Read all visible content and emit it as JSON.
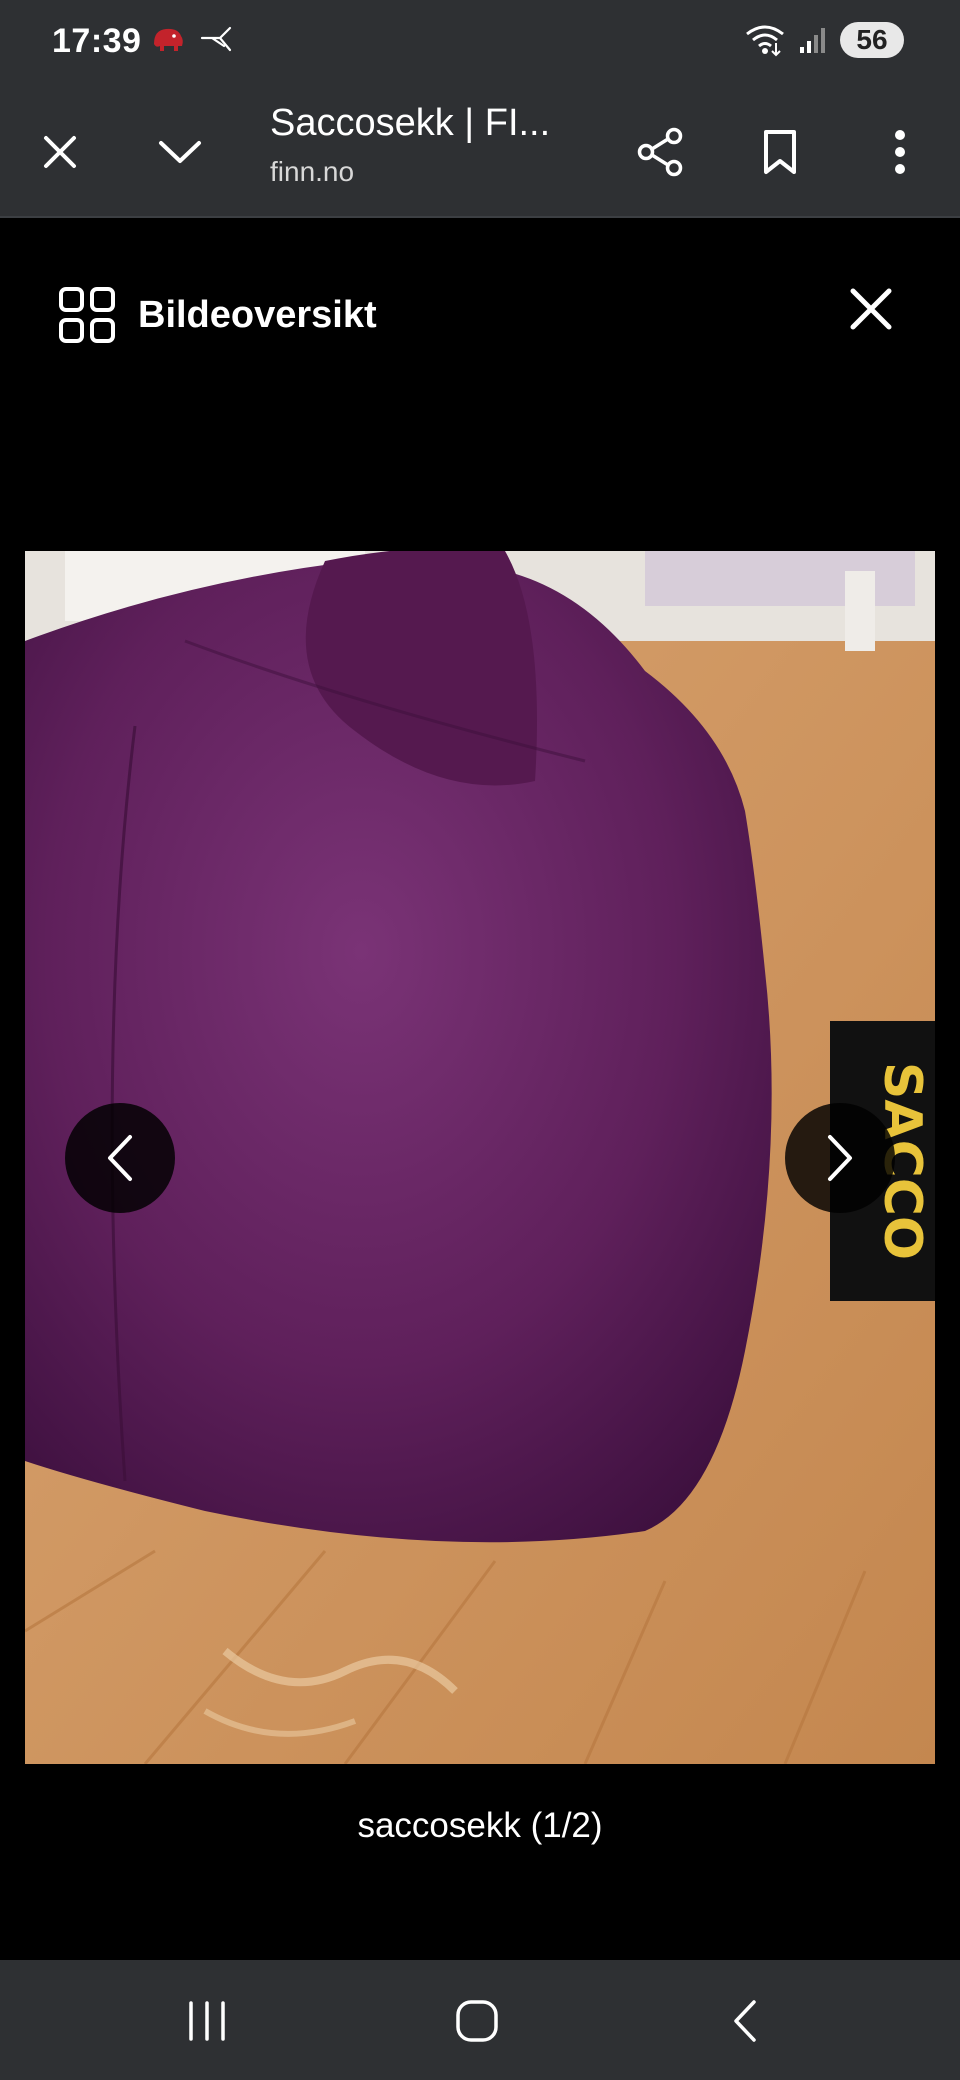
{
  "status_bar": {
    "time": "17:39",
    "battery": "56",
    "icons_left": [
      "elephant-notification-icon",
      "bird-notification-icon"
    ],
    "icons_right": [
      "wifi-icon",
      "signal-icon"
    ]
  },
  "browser": {
    "page_title": "Saccosekk | FI...",
    "domain": "finn.no",
    "icons": [
      "close-icon",
      "chevron-down-icon",
      "share-icon",
      "bookmark-icon",
      "more-vert-icon"
    ]
  },
  "gallery": {
    "overview_label": "Bildeoversikt",
    "caption": "saccosekk (1/2)",
    "photo_label_text": "SACCO ORIGINAL",
    "colors": {
      "bag": "#5e1f5a",
      "floor": "#c98f5e",
      "background": "#000000"
    }
  },
  "system_nav": {
    "icons": [
      "recents-icon",
      "home-icon",
      "back-icon"
    ]
  }
}
